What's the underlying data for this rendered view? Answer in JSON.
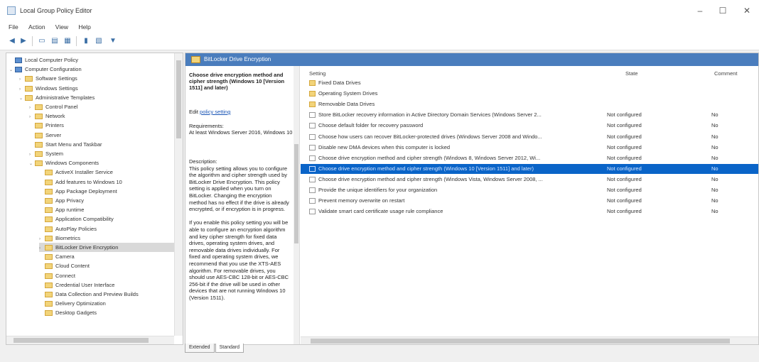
{
  "window": {
    "title": "Local Group Policy Editor",
    "minimize": "–",
    "maximize": "☐",
    "close": "✕"
  },
  "menu": [
    "File",
    "Action",
    "View",
    "Help"
  ],
  "toolbar": {
    "back_icon": "arrow-left-icon",
    "forward_icon": "arrow-right-icon",
    "filter_icon": "filter-icon"
  },
  "tree": [
    {
      "label": "Local Computer Policy",
      "level": 0,
      "type": "pc",
      "expand": ""
    },
    {
      "label": "Computer Configuration",
      "level": 0,
      "type": "pc",
      "expand": "⌄"
    },
    {
      "label": "Software Settings",
      "level": 1,
      "type": "folder",
      "expand": "›"
    },
    {
      "label": "Windows Settings",
      "level": 1,
      "type": "folder",
      "expand": "›"
    },
    {
      "label": "Administrative Templates",
      "level": 1,
      "type": "folder",
      "expand": "⌄"
    },
    {
      "label": "Control Panel",
      "level": 2,
      "type": "folder",
      "expand": "›"
    },
    {
      "label": "Network",
      "level": 2,
      "type": "folder",
      "expand": "›"
    },
    {
      "label": "Printers",
      "level": 2,
      "type": "folder",
      "expand": ""
    },
    {
      "label": "Server",
      "level": 2,
      "type": "folder",
      "expand": ""
    },
    {
      "label": "Start Menu and Taskbar",
      "level": 2,
      "type": "folder",
      "expand": ""
    },
    {
      "label": "System",
      "level": 2,
      "type": "folder",
      "expand": "›"
    },
    {
      "label": "Windows Components",
      "level": 2,
      "type": "folder",
      "expand": "⌄"
    },
    {
      "label": "ActiveX Installer Service",
      "level": 3,
      "type": "folder",
      "expand": ""
    },
    {
      "label": "Add features to Windows 10",
      "level": 3,
      "type": "folder",
      "expand": ""
    },
    {
      "label": "App Package Deployment",
      "level": 3,
      "type": "folder",
      "expand": ""
    },
    {
      "label": "App Privacy",
      "level": 3,
      "type": "folder",
      "expand": ""
    },
    {
      "label": "App runtime",
      "level": 3,
      "type": "folder",
      "expand": ""
    },
    {
      "label": "Application Compatibility",
      "level": 3,
      "type": "folder",
      "expand": ""
    },
    {
      "label": "AutoPlay Policies",
      "level": 3,
      "type": "folder",
      "expand": ""
    },
    {
      "label": "Biometrics",
      "level": 3,
      "type": "folder",
      "expand": "›"
    },
    {
      "label": "BitLocker Drive Encryption",
      "level": 3,
      "type": "folder",
      "expand": "›",
      "selected": true
    },
    {
      "label": "Camera",
      "level": 3,
      "type": "folder",
      "expand": ""
    },
    {
      "label": "Cloud Content",
      "level": 3,
      "type": "folder",
      "expand": ""
    },
    {
      "label": "Connect",
      "level": 3,
      "type": "folder",
      "expand": ""
    },
    {
      "label": "Credential User Interface",
      "level": 3,
      "type": "folder",
      "expand": ""
    },
    {
      "label": "Data Collection and Preview Builds",
      "level": 3,
      "type": "folder",
      "expand": ""
    },
    {
      "label": "Delivery Optimization",
      "level": 3,
      "type": "folder",
      "expand": ""
    },
    {
      "label": "Desktop Gadgets",
      "level": 3,
      "type": "folder",
      "expand": ""
    }
  ],
  "header": {
    "title": "BitLocker Drive Encryption"
  },
  "description": {
    "title": "Choose drive encryption method and cipher strength (Windows 10 [Version 1511] and later)",
    "edit_prefix": "Edit",
    "edit_link": "policy setting",
    "requirements": "Requirements:\nAt least Windows Server 2016, Windows 10",
    "body": "Description:\nThis policy setting allows you to configure the algorithm and cipher strength used by BitLocker Drive Encryption. This policy setting is applied when you turn on BitLocker. Changing the encryption method has no effect if the drive is already encrypted, or if encryption is in progress.\n\nIf you enable this policy setting you will be able to configure an encryption algorithm and key cipher strength for fixed data drives, operating system drives, and removable data drives individually. For fixed and operating system drives, we recommend that you use the XTS-AES algorithm. For removable drives, you should use AES-CBC 128-bit or AES-CBC 256-bit if the drive will be used in other devices that are not running Windows 10 (Version 1511)."
  },
  "columns": {
    "setting": "Setting",
    "state": "State",
    "comment": "Comment"
  },
  "rows": [
    {
      "name": "Fixed Data Drives",
      "type": "folder",
      "state": "",
      "comment": ""
    },
    {
      "name": "Operating System Drives",
      "type": "folder",
      "state": "",
      "comment": ""
    },
    {
      "name": "Removable Data Drives",
      "type": "folder",
      "state": "",
      "comment": ""
    },
    {
      "name": "Store BitLocker recovery information in Active Directory Domain Services (Windows Server 2...",
      "type": "policy",
      "state": "Not configured",
      "comment": "No"
    },
    {
      "name": "Choose default folder for recovery password",
      "type": "policy",
      "state": "Not configured",
      "comment": "No"
    },
    {
      "name": "Choose how users can recover BitLocker-protected drives (Windows Server 2008 and Windo...",
      "type": "policy",
      "state": "Not configured",
      "comment": "No"
    },
    {
      "name": "Disable new DMA devices when this computer is locked",
      "type": "policy",
      "state": "Not configured",
      "comment": "No"
    },
    {
      "name": "Choose drive encryption method and cipher strength (Windows 8, Windows Server 2012, Wi...",
      "type": "policy",
      "state": "Not configured",
      "comment": "No"
    },
    {
      "name": "Choose drive encryption method and cipher strength (Windows 10 [Version 1511] and later)",
      "type": "policy",
      "state": "Not configured",
      "comment": "No",
      "selected": true
    },
    {
      "name": "Choose drive encryption method and cipher strength (Windows Vista, Windows Server 2008, ...",
      "type": "policy",
      "state": "Not configured",
      "comment": "No"
    },
    {
      "name": "Provide the unique identifiers for your organization",
      "type": "policy",
      "state": "Not configured",
      "comment": "No"
    },
    {
      "name": "Prevent memory overwrite on restart",
      "type": "policy",
      "state": "Not configured",
      "comment": "No"
    },
    {
      "name": "Validate smart card certificate usage rule compliance",
      "type": "policy",
      "state": "Not configured",
      "comment": "No"
    }
  ],
  "tabs": [
    "Extended",
    "Standard"
  ]
}
